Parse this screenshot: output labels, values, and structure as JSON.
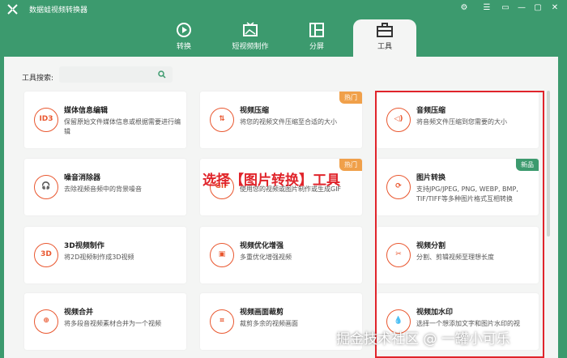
{
  "app": {
    "title": "数据蛙视频转换器",
    "accent": "#3c9a6e"
  },
  "window_controls": [
    "⚙",
    "☰",
    "—",
    "▢",
    "✕"
  ],
  "tabs": [
    {
      "label": "转换",
      "icon": "convert-icon"
    },
    {
      "label": "短视频制作",
      "icon": "tv-icon"
    },
    {
      "label": "分屏",
      "icon": "split-screen-icon"
    },
    {
      "label": "工具",
      "icon": "toolbox-icon",
      "active": true
    }
  ],
  "search": {
    "label": "工具搜索:",
    "value": ""
  },
  "cards": [
    {
      "title": "媒体信息编辑",
      "desc": "保留原始文件媒体信息或根据需要进行编辑",
      "icon": "ID3",
      "badge": ""
    },
    {
      "title": "视频压缩",
      "desc": "将您的视频文件压缩至合适的大小",
      "icon": "⇅",
      "badge": "热门"
    },
    {
      "title": "音频压缩",
      "desc": "将音频文件压缩到您需要的大小",
      "icon": "◁)",
      "badge": ""
    },
    {
      "title": "噪音消除器",
      "desc": "去除视频音频中的背景噪音",
      "icon": "🎧",
      "badge": ""
    },
    {
      "title": "",
      "desc": "使用您的视频或图片制作或生成GIF",
      "icon": "GIF",
      "badge": "热门"
    },
    {
      "title": "图片转换",
      "desc": "支持JPG/JPEG, PNG, WEBP, BMP, TIF/TIFF等多种图片格式互相转换",
      "icon": "⟳",
      "badge": "新品"
    },
    {
      "title": "3D视频制作",
      "desc": "将2D视频制作成3D视频",
      "icon": "3D",
      "badge": ""
    },
    {
      "title": "视频优化增强",
      "desc": "多重优化增强视频",
      "icon": "▣",
      "badge": ""
    },
    {
      "title": "视频分割",
      "desc": "分割、剪辑视频至理想长度",
      "icon": "✂",
      "badge": ""
    },
    {
      "title": "视频合并",
      "desc": "将多段音视频素材合并为一个视频",
      "icon": "⊕",
      "badge": ""
    },
    {
      "title": "视频画面裁剪",
      "desc": "裁剪多余的视频画面",
      "icon": "⌗",
      "badge": ""
    },
    {
      "title": "视频加水印",
      "desc": "选择一个想添加文字和图片水印的视",
      "icon": "💧",
      "badge": ""
    }
  ],
  "annotation": "选择【图片转换】工具",
  "watermark": "掘金技术社区 @ 一罐小可乐"
}
